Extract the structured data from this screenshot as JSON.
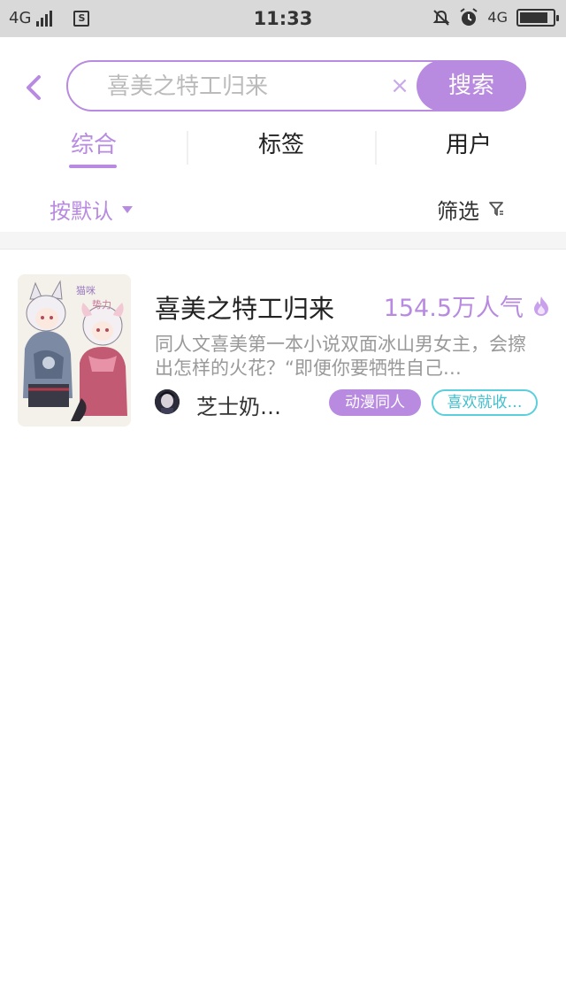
{
  "status_bar": {
    "network_left": "4G",
    "time": "11:33",
    "network_right": "4G",
    "battery_level": 0.85
  },
  "search": {
    "value": "",
    "placeholder": "喜美之特工归来",
    "clear_symbol": "×",
    "button_label": "搜索"
  },
  "tabs": [
    {
      "label": "综合",
      "active": true
    },
    {
      "label": "标签",
      "active": false
    },
    {
      "label": "用户",
      "active": false
    }
  ],
  "filters": {
    "sort_label": "按默认",
    "filter_label": "筛选"
  },
  "results": [
    {
      "title": "喜美之特工归来",
      "popularity": "154.5万人气",
      "description": "同人文喜美第一本小说双面冰山男女主，会擦出怎样的火花？“即便你要牺牲自己…",
      "author": "芝士奶…",
      "category_tag": "动漫同人",
      "secondary_tag": "喜欢就收…",
      "cover_text": "猫咪势力"
    }
  ],
  "colors": {
    "accent": "#b88ae0",
    "tag_teal": "#5ccfdc",
    "status_bar_bg": "#d9d9d9"
  }
}
